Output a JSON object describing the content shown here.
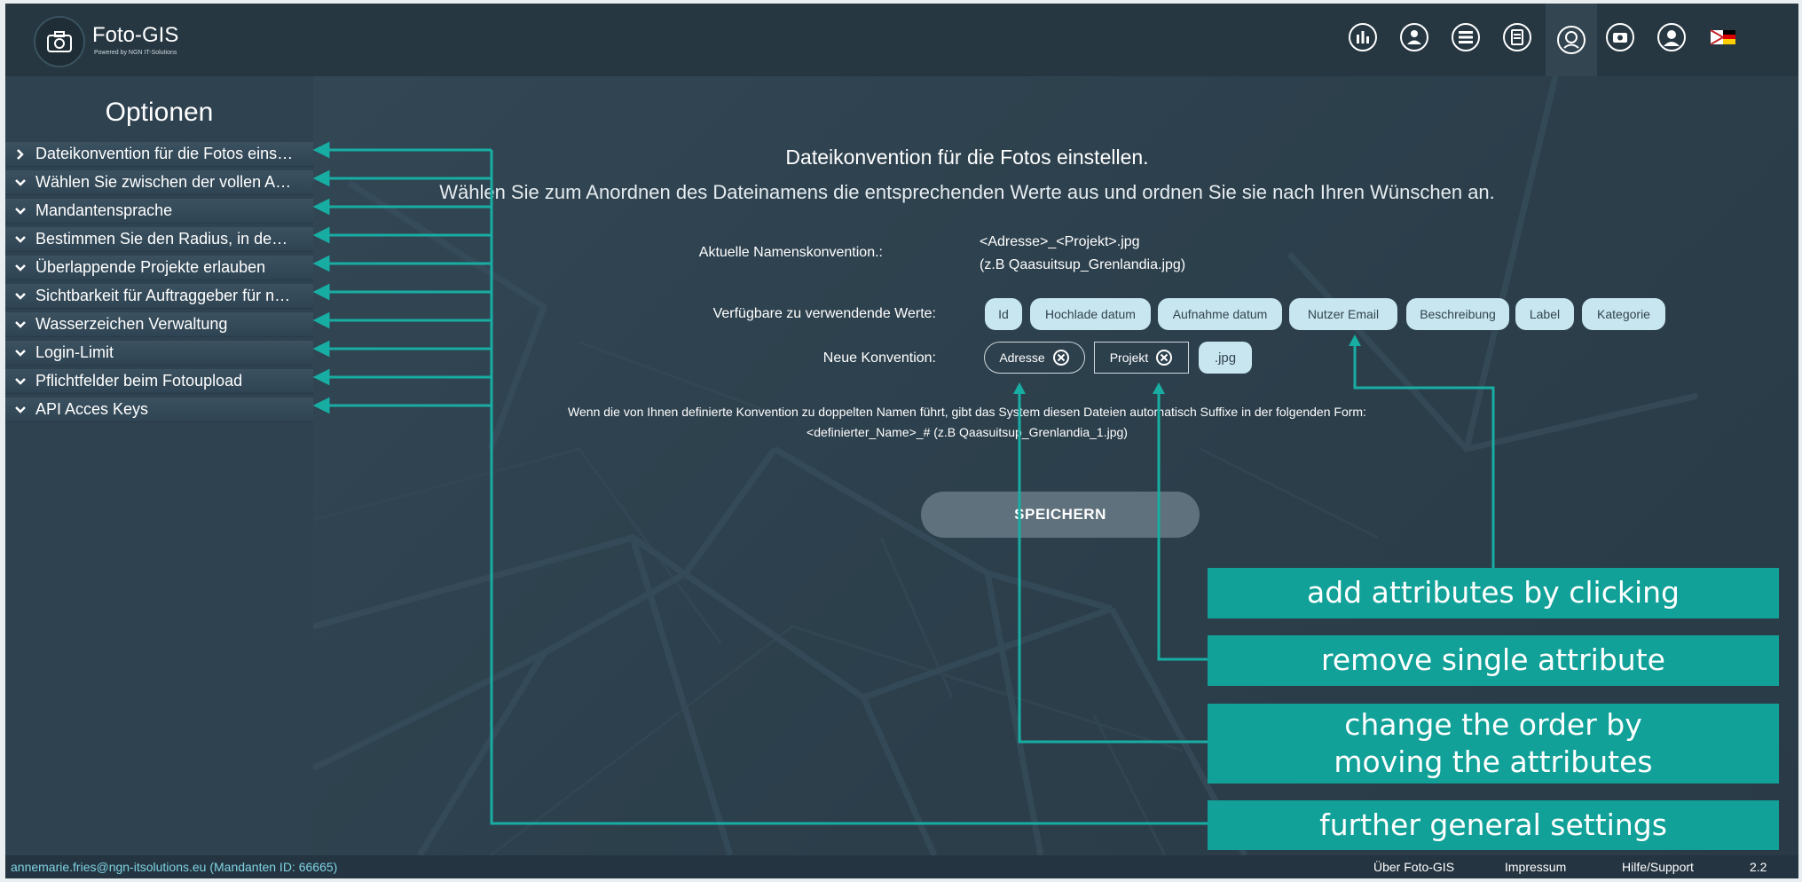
{
  "header": {
    "app_title": "Foto-GIS",
    "app_subtitle": "Powered by NGN IT-Solutions",
    "icons": [
      "statistics-icon",
      "map-user-icon",
      "layers-icon",
      "clipboard-icon",
      "settings-user-icon",
      "camera-settings-icon",
      "profile-icon",
      "flag-icon"
    ]
  },
  "sidebar": {
    "title": "Optionen",
    "items": [
      {
        "label": "Dateikonvention für die Fotos eins…",
        "expanded": false
      },
      {
        "label": "Wählen Sie zwischen der vollen A…",
        "expanded": true
      },
      {
        "label": "Mandantensprache",
        "expanded": true
      },
      {
        "label": "Bestimmen Sie den Radius, in de…",
        "expanded": true
      },
      {
        "label": "Überlappende Projekte erlauben",
        "expanded": true
      },
      {
        "label": "Sichtbarkeit für Auftraggeber für n…",
        "expanded": true
      },
      {
        "label": "Wasserzeichen Verwaltung",
        "expanded": true
      },
      {
        "label": "Login-Limit",
        "expanded": true
      },
      {
        "label": "Pflichtfelder beim Fotoupload",
        "expanded": true
      },
      {
        "label": "API Acces Keys",
        "expanded": true
      }
    ]
  },
  "main": {
    "title": "Dateikonvention für die Fotos einstellen.",
    "subtitle": "Wählen Sie zum Anordnen des Dateinamens die entsprechenden Werte aus und ordnen Sie sie nach Ihren Wünschen an.",
    "current_label": "Aktuelle Namenskonvention.:",
    "current_value": "<Adresse>_<Projekt>.jpg",
    "current_example": "(z.B Qaasuitsup_Grenlandia.jpg)",
    "available_label": "Verfügbare zu verwendende Werte:",
    "available_values": [
      "Id",
      "Hochlade datum",
      "Aufnahme datum",
      "Nutzer Email",
      "Beschreibung",
      "Label",
      "Kategorie"
    ],
    "new_label": "Neue Konvention:",
    "new_items": [
      "Adresse",
      "Projekt"
    ],
    "extension": ".jpg",
    "note_line1": "Wenn die von Ihnen definierte Konvention zu doppelten Namen führt, gibt das System diesen Dateien automatisch Suffixe in der folgenden Form:",
    "note_line2": "<definierter_Name>_# (z.B Qaasuitsup_Grenlandia_1.jpg)",
    "save_label": "SPEICHERN"
  },
  "annotations": {
    "add": "add attributes by clicking",
    "remove": "remove single attribute",
    "order_line1": "change the order by",
    "order_line2": "moving the attributes",
    "general": "further general settings"
  },
  "footer": {
    "user": "annemarie.fries@ngn-itsolutions.eu (Mandanten ID: 66665)",
    "about": "Über Foto-GIS",
    "impressum": "Impressum",
    "help": "Hilfe/Support",
    "version": "2.2"
  },
  "colors": {
    "accent": "#11a198",
    "chip": "#c8e6ef",
    "header": "#263742",
    "sidebar": "#2f4250"
  }
}
